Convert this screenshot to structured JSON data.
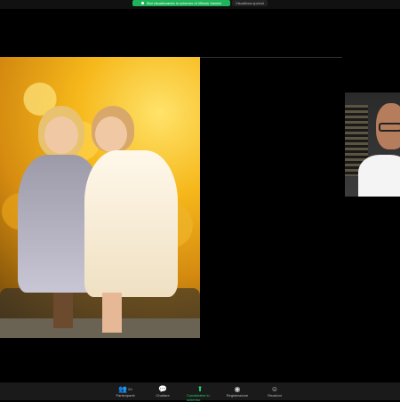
{
  "banner": {
    "share_text": "Stai visualizzando lo schermo di Vittorio Vannini",
    "view_options": "Visualizza opzioni"
  },
  "participant": {
    "tile_icon": "person-video"
  },
  "toolbar": {
    "participants": {
      "label": "Partecipanti",
      "count": "84"
    },
    "chat": {
      "label": "Chattare"
    },
    "share": {
      "label": "Condividere lo schermo"
    },
    "record": {
      "label": "Registrazione"
    },
    "reactions": {
      "label": "Reazioni"
    }
  },
  "colors": {
    "share_green": "#1fb45a",
    "toolbar_bg": "#1a1a1a"
  }
}
